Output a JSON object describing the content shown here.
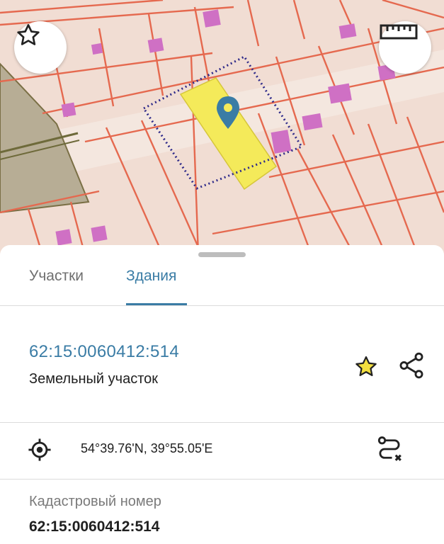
{
  "tabs": [
    {
      "label": "Участки",
      "active": false
    },
    {
      "label": "Здания",
      "active": true
    }
  ],
  "parcel": {
    "cadastral_title": "62:15:0060412:514",
    "type_label": "Земельный участок",
    "favorite": true
  },
  "location": {
    "coordinates": "54°39.76'N, 39°55.05'E"
  },
  "details": {
    "cadastral_label": "Кадастровый номер",
    "cadastral_value": "62:15:0060412:514"
  },
  "colors": {
    "accent": "#3a7ca5",
    "star_fill": "#f3df3f",
    "parcel_fill": "#f4ea5a",
    "parcel_lines": "#e5694f",
    "building": "#cf70c4",
    "boundary_dots": "#2f2b8a"
  },
  "icons": {
    "favorite_map": "star-outline-icon",
    "ruler": "ruler-icon",
    "pin": "map-pin-icon",
    "favorite": "star-filled-icon",
    "share": "share-icon",
    "locate": "locate-icon",
    "route": "route-icon"
  }
}
